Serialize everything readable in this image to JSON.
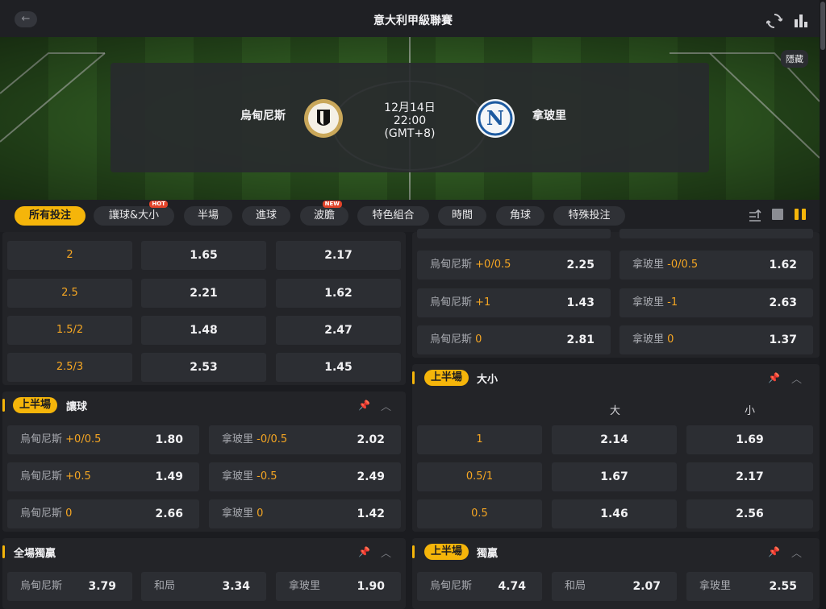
{
  "header": {
    "title": "意大利甲級聯賽"
  },
  "hero": {
    "hide_label": "隱藏",
    "home_team": "烏甸尼斯",
    "away_team": "拿玻里",
    "date": "12月14日",
    "time": "22:00",
    "timezone": "(GMT+8)"
  },
  "tabs": [
    {
      "label": "所有投注",
      "active": true
    },
    {
      "label": "讓球&大小",
      "tag": "HOT"
    },
    {
      "label": "半場"
    },
    {
      "label": "進球"
    },
    {
      "label": "波膽",
      "tag": "NEW"
    },
    {
      "label": "特色組合"
    },
    {
      "label": "時間"
    },
    {
      "label": "角球"
    },
    {
      "label": "特殊投注"
    }
  ],
  "left_top_rows": [
    {
      "line": "2",
      "over": "1.65",
      "under": "2.17"
    },
    {
      "line": "2.5",
      "over": "2.21",
      "under": "1.62"
    },
    {
      "line": "1.5/2",
      "over": "1.48",
      "under": "2.47"
    },
    {
      "line": "2.5/3",
      "over": "2.53",
      "under": "1.45"
    }
  ],
  "right_top_rows": [
    {
      "home": "烏甸尼斯",
      "home_line": "+0/0.5",
      "home_odd": "2.25",
      "away": "拿玻里",
      "away_line": "-0/0.5",
      "away_odd": "1.62"
    },
    {
      "home": "烏甸尼斯",
      "home_line": "+1",
      "home_odd": "1.43",
      "away": "拿玻里",
      "away_line": "-1",
      "away_odd": "2.63"
    },
    {
      "home": "烏甸尼斯",
      "home_line": "0",
      "home_odd": "2.81",
      "away": "拿玻里",
      "away_line": "0",
      "away_odd": "1.37"
    }
  ],
  "first_half_handicap": {
    "badge": "上半場",
    "title": "讓球",
    "rows": [
      {
        "home": "烏甸尼斯",
        "home_line": "+0/0.5",
        "home_odd": "1.80",
        "away": "拿玻里",
        "away_line": "-0/0.5",
        "away_odd": "2.02"
      },
      {
        "home": "烏甸尼斯",
        "home_line": "+0.5",
        "home_odd": "1.49",
        "away": "拿玻里",
        "away_line": "-0.5",
        "away_odd": "2.49"
      },
      {
        "home": "烏甸尼斯",
        "home_line": "0",
        "home_odd": "2.66",
        "away": "拿玻里",
        "away_line": "0",
        "away_odd": "1.42"
      }
    ]
  },
  "first_half_ou": {
    "badge": "上半場",
    "title": "大小",
    "over_label": "大",
    "under_label": "小",
    "rows": [
      {
        "line": "1",
        "over": "2.14",
        "under": "1.69"
      },
      {
        "line": "0.5/1",
        "over": "1.67",
        "under": "2.17"
      },
      {
        "line": "0.5",
        "over": "1.46",
        "under": "2.56"
      }
    ]
  },
  "full_time_1x2": {
    "title": "全場獨贏",
    "home": "烏甸尼斯",
    "home_odd": "3.79",
    "draw": "和局",
    "draw_odd": "3.34",
    "away": "拿玻里",
    "away_odd": "1.90"
  },
  "first_half_1x2": {
    "badge": "上半場",
    "title": "獨贏",
    "home": "烏甸尼斯",
    "home_odd": "4.74",
    "draw": "和局",
    "draw_odd": "2.07",
    "away": "拿玻里",
    "away_odd": "2.55"
  },
  "colors": {
    "accent": "#f5b50a",
    "line_text": "#f5a623",
    "panel": "#232428",
    "cell": "#2c2e33"
  }
}
